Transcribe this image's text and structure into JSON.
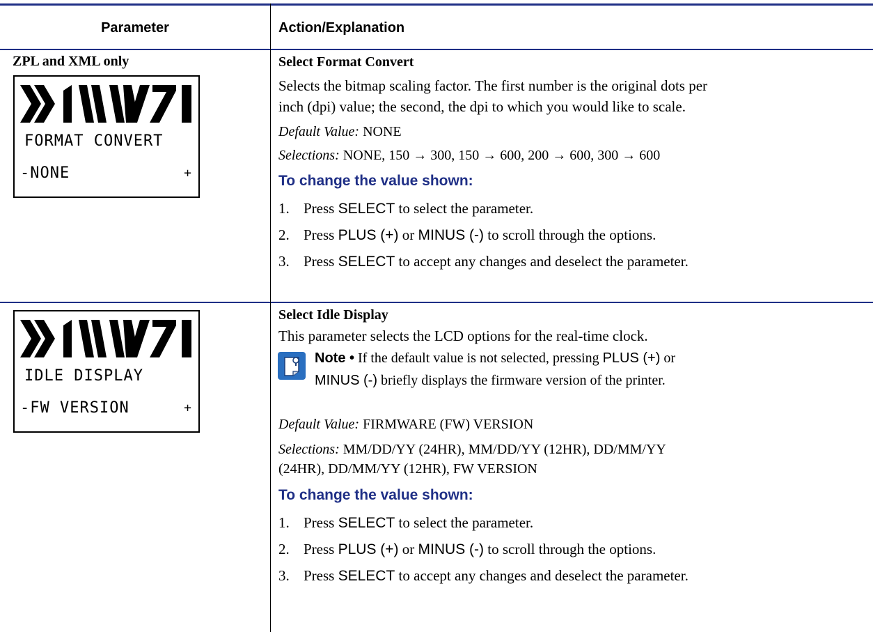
{
  "header": {
    "parameter": "Parameter",
    "action": "Action/Explanation"
  },
  "row1": {
    "label": "ZPL and XML only",
    "lcd": {
      "line1": "FORMAT CONVERT",
      "line2": "-NONE",
      "plus": "+"
    },
    "title": "Select Format Convert",
    "desc_line1": "Selects the bitmap scaling factor. The first number is the original dots per",
    "desc_line2": "inch (dpi) value; the second, the dpi to which you would like to scale.",
    "default_label": "Default Value:",
    "default_value": "NONE",
    "selections_label": "Selections:",
    "selections_value": "NONE, 150 → 300, 150 → 600, 200 → 600, 300 → 600",
    "procedure_heading": "To change the value shown:",
    "steps": [
      {
        "num": "1.",
        "pre": "Press ",
        "key": "SELECT",
        "post": " to select the parameter."
      },
      {
        "num": "2.",
        "pre": "Press ",
        "key": "PLUS (+)",
        "mid": " or ",
        "key2": "MINUS (-)",
        "post": " to scroll through the options."
      },
      {
        "num": "3.",
        "pre": "Press ",
        "key": "SELECT",
        "post": " to accept any changes and deselect the parameter."
      }
    ]
  },
  "row2": {
    "lcd": {
      "line1": "IDLE DISPLAY",
      "line2": "-FW VERSION",
      "plus": "+"
    },
    "title": "Select Idle Display",
    "desc": "This parameter selects the LCD options for the real-time clock.",
    "note": {
      "icon": "note-icon",
      "label": "Note •",
      "text1": " If the default value is not selected, pressing ",
      "key1": "PLUS (+)",
      "text1b": " or",
      "key2": "MINUS (-)",
      "text2": " briefly displays the firmware version of the printer."
    },
    "default_label": "Default Value:",
    "default_value": "FIRMWARE (FW) VERSION",
    "selections_label": "Selections:",
    "selections_line1": "MM/DD/YY (24HR), MM/DD/YY (12HR), DD/MM/YY",
    "selections_line2": "(24HR), DD/MM/YY (12HR), FW VERSION",
    "procedure_heading": "To change the value shown:",
    "steps": [
      {
        "num": "1.",
        "pre": "Press ",
        "key": "SELECT",
        "post": " to select the parameter."
      },
      {
        "num": "2.",
        "pre": "Press ",
        "key": "PLUS (+)",
        "mid": " or ",
        "key2": "MINUS (-)",
        "post": " to scroll through the options."
      },
      {
        "num": "3.",
        "pre": "Press ",
        "key": "SELECT",
        "post": " to accept any changes and deselect the parameter."
      }
    ]
  }
}
